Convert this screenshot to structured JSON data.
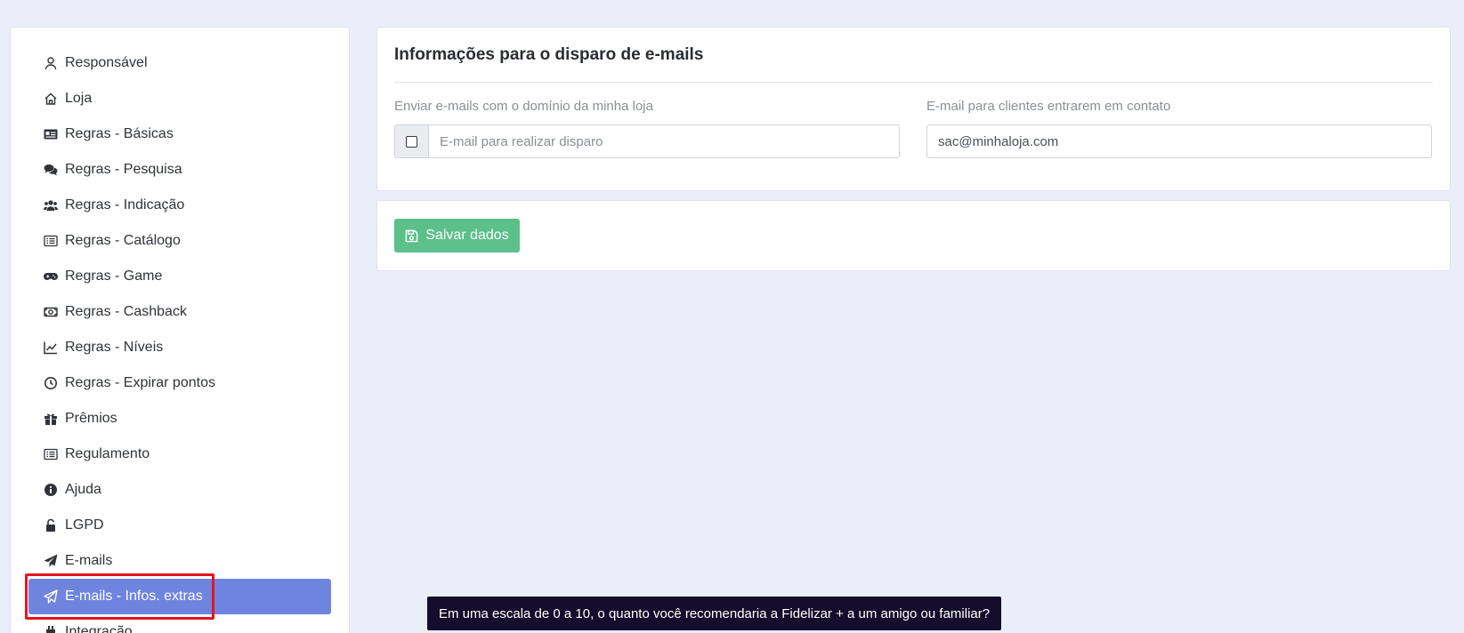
{
  "sidebar": {
    "items": [
      {
        "label": "Responsável",
        "icon": "user-icon"
      },
      {
        "label": "Loja",
        "icon": "home-icon"
      },
      {
        "label": "Regras - Básicas",
        "icon": "id-card-icon"
      },
      {
        "label": "Regras - Pesquisa",
        "icon": "comments-icon"
      },
      {
        "label": "Regras - Indicação",
        "icon": "users-icon"
      },
      {
        "label": "Regras - Catálogo",
        "icon": "list-alt-icon"
      },
      {
        "label": "Regras - Game",
        "icon": "gamepad-icon"
      },
      {
        "label": "Regras - Cashback",
        "icon": "money-bill-icon"
      },
      {
        "label": "Regras - Níveis",
        "icon": "chart-line-icon"
      },
      {
        "label": "Regras - Expirar pontos",
        "icon": "clock-icon"
      },
      {
        "label": "Prêmios",
        "icon": "gift-icon"
      },
      {
        "label": "Regulamento",
        "icon": "list-alt-icon"
      },
      {
        "label": "Ajuda",
        "icon": "info-circle-icon"
      },
      {
        "label": "LGPD",
        "icon": "unlock-icon"
      },
      {
        "label": "E-mails",
        "icon": "paper-plane-icon"
      },
      {
        "label": "E-mails - Infos. extras",
        "icon": "paper-plane-outline-icon"
      },
      {
        "label": "Integração",
        "icon": "plug-icon"
      }
    ],
    "active_index": 15,
    "active_color": "#6f84df"
  },
  "info_card": {
    "title": "Informações para o disparo de e-mails",
    "domain_field": {
      "label": "Enviar e-mails com o domínio da minha loja",
      "placeholder": "E-mail para realizar disparo",
      "checked": false
    },
    "contact_field": {
      "label": "E-mail para clientes entrarem em contato",
      "value": "sac@minhaloja.com"
    }
  },
  "actions": {
    "save_label": "Salvar dados",
    "save_color": "#5cc08a"
  },
  "survey": {
    "text": "Em uma escala de 0 a 10, o quanto você recomendaria a Fidelizar + a um amigo ou familiar?"
  }
}
